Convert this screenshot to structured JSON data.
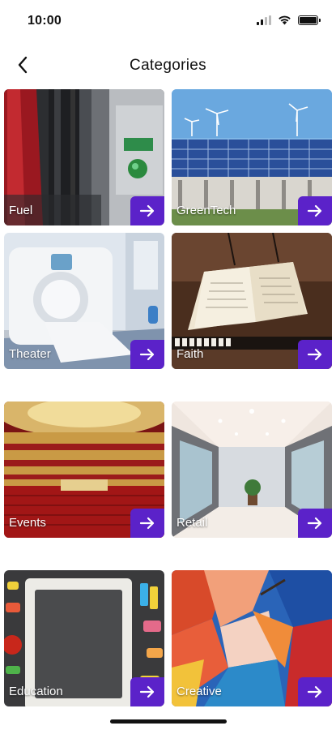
{
  "status": {
    "time": "10:00"
  },
  "header": {
    "title": "Categories"
  },
  "accent_color": "#5b22c9",
  "categories": [
    {
      "label": "Fuel",
      "icon": "arrow-right-icon"
    },
    {
      "label": "GreenTech",
      "icon": "arrow-right-icon"
    },
    {
      "label": "Theater",
      "icon": "arrow-right-icon"
    },
    {
      "label": "Faith",
      "icon": "arrow-right-icon"
    },
    {
      "label": "Events",
      "icon": "arrow-right-icon"
    },
    {
      "label": "Retail",
      "icon": "arrow-right-icon"
    },
    {
      "label": "Education",
      "icon": "arrow-right-icon"
    },
    {
      "label": "Creative",
      "icon": "arrow-right-icon"
    }
  ]
}
